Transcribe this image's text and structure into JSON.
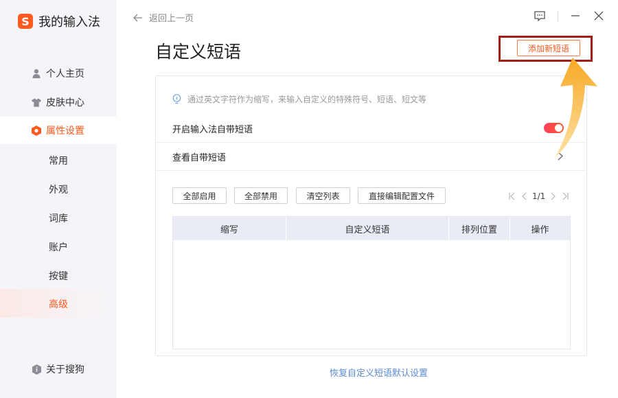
{
  "app": {
    "logo_letter": "S",
    "title": "我的输入法"
  },
  "sidebar": {
    "items": [
      {
        "label": "个人主页",
        "icon": "person-icon"
      },
      {
        "label": "皮肤中心",
        "icon": "shirt-icon"
      },
      {
        "label": "属性设置",
        "icon": "settings-hex-icon"
      }
    ],
    "subitems": [
      "常用",
      "外观",
      "词库",
      "账户",
      "按键",
      "高级"
    ],
    "about": {
      "label": "关于搜狗",
      "icon": "info-shield-icon"
    }
  },
  "topbar": {
    "back_label": "返回上一页"
  },
  "page": {
    "title": "自定义短语",
    "add_button": "添加新短语",
    "hint": "通过英文字符作为缩写，来输入自定义的特殊符号、短语、短文等",
    "enable_label": "开启输入法自带短语",
    "enable_on": true,
    "view_label": "查看自带短语",
    "actions": [
      "全部启用",
      "全部禁用",
      "清空列表",
      "直接编辑配置文件"
    ],
    "pager": {
      "text": "1/1"
    },
    "table": {
      "columns": [
        "缩写",
        "自定义短语",
        "排列位置",
        "操作"
      ],
      "rows": []
    },
    "restore_link": "恢复自定义短语默认设置"
  },
  "colors": {
    "accent": "#ff5a1f",
    "highlight_box": "#a31d14",
    "arrow": "#f9b233",
    "link": "#5b8ad6"
  }
}
